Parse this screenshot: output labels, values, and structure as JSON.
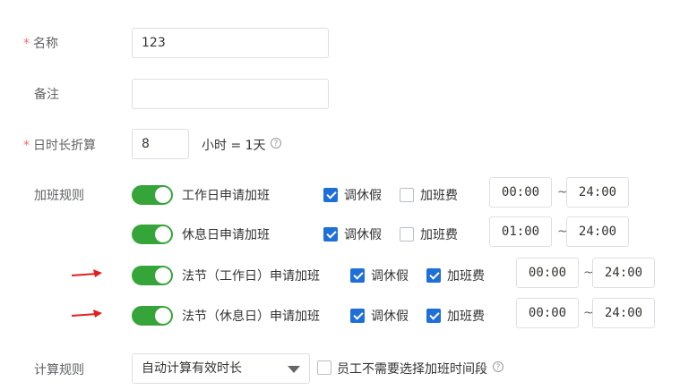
{
  "form": {
    "name": {
      "required_mark": "*",
      "label": "名称",
      "value": "123"
    },
    "remark": {
      "label": "备注",
      "value": ""
    },
    "day_length": {
      "required_mark": "*",
      "label": "日时长折算",
      "value": "8",
      "suffix": "小时 = 1天",
      "help_icon": "question-circle-icon"
    }
  },
  "overtime": {
    "label": "加班规则",
    "rules": [
      {
        "label": "工作日申请加班",
        "enabled": true,
        "comp_leave_label": "调休假",
        "comp_leave_checked": true,
        "pay_label": "加班费",
        "pay_checked": false,
        "start": "00:00",
        "end": "24:00",
        "separator": "~",
        "arrow": false
      },
      {
        "label": "休息日申请加班",
        "enabled": true,
        "comp_leave_label": "调休假",
        "comp_leave_checked": true,
        "pay_label": "加班费",
        "pay_checked": false,
        "start": "01:00",
        "end": "24:00",
        "separator": "~",
        "arrow": false
      },
      {
        "label": "法节（工作日）申请加班",
        "enabled": true,
        "comp_leave_label": "调休假",
        "comp_leave_checked": true,
        "pay_label": "加班费",
        "pay_checked": true,
        "start": "00:00",
        "end": "24:00",
        "separator": "~",
        "arrow": true
      },
      {
        "label": "法节（休息日）申请加班",
        "enabled": true,
        "comp_leave_label": "调休假",
        "comp_leave_checked": true,
        "pay_label": "加班费",
        "pay_checked": true,
        "start": "00:00",
        "end": "24:00",
        "separator": "~",
        "arrow": true
      }
    ]
  },
  "calc": {
    "label": "计算规则",
    "selected": "自动计算有效时长",
    "no_select_label": "员工不需要选择加班时间段",
    "no_select_checked": false,
    "help_icon": "question-circle-icon"
  },
  "colors": {
    "switch_on": "#36a539",
    "checkbox_on": "#1e6fd9",
    "required": "#f56c6c",
    "arrow": "#e02020"
  }
}
